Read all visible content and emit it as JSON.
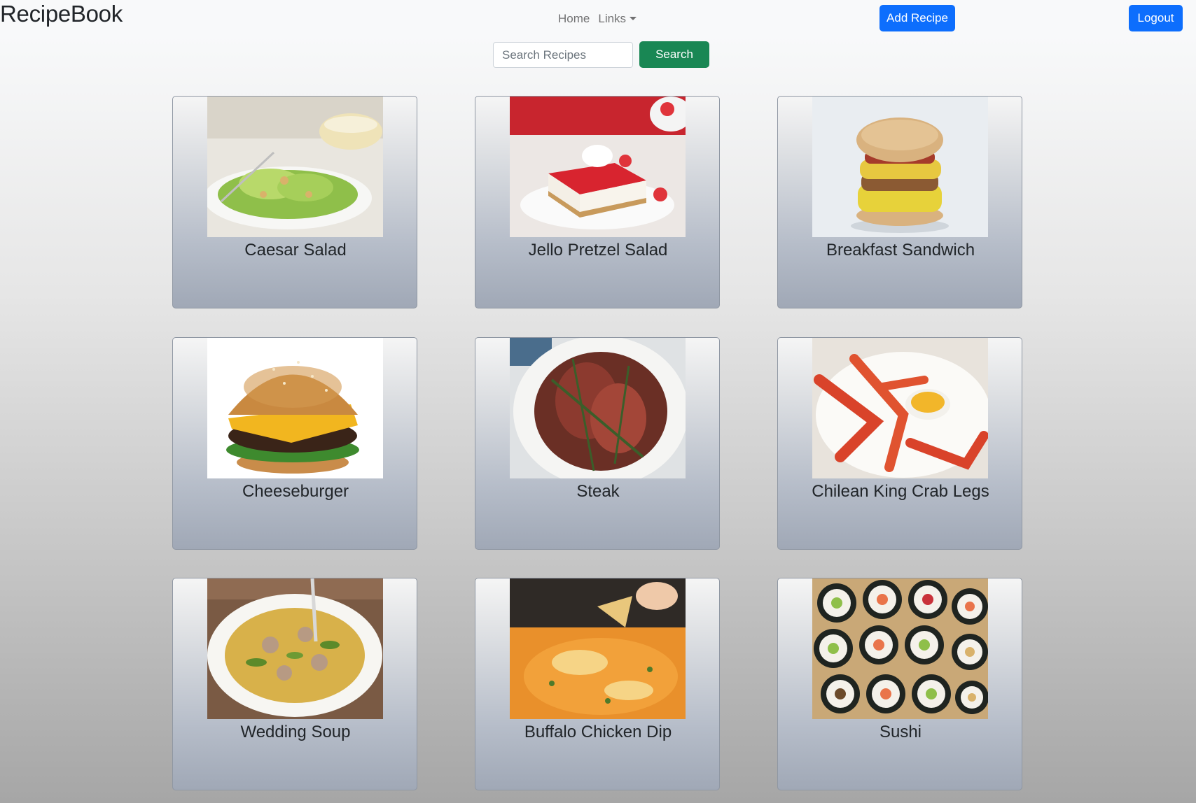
{
  "navbar": {
    "brand": "RecipeBook",
    "links": [
      {
        "label": "Home"
      },
      {
        "label": "Links"
      }
    ],
    "add_recipe_label": "Add Recipe",
    "logout_label": "Logout"
  },
  "search": {
    "placeholder": "Search Recipes",
    "value": "",
    "button_label": "Search"
  },
  "recipes": [
    {
      "title": "Caesar Salad",
      "image": "caesar-salad"
    },
    {
      "title": "Jello Pretzel Salad",
      "image": "jello-pretzel-salad"
    },
    {
      "title": "Breakfast Sandwich",
      "image": "breakfast-sandwich"
    },
    {
      "title": "Cheeseburger",
      "image": "cheeseburger"
    },
    {
      "title": "Steak",
      "image": "steak"
    },
    {
      "title": "Chilean King Crab Legs",
      "image": "king-crab-legs"
    },
    {
      "title": "Wedding Soup",
      "image": "wedding-soup"
    },
    {
      "title": "Buffalo Chicken Dip",
      "image": "buffalo-chicken-dip"
    },
    {
      "title": "Sushi",
      "image": "sushi"
    }
  ],
  "colors": {
    "primary": "#0d6efd",
    "success": "#198754"
  }
}
